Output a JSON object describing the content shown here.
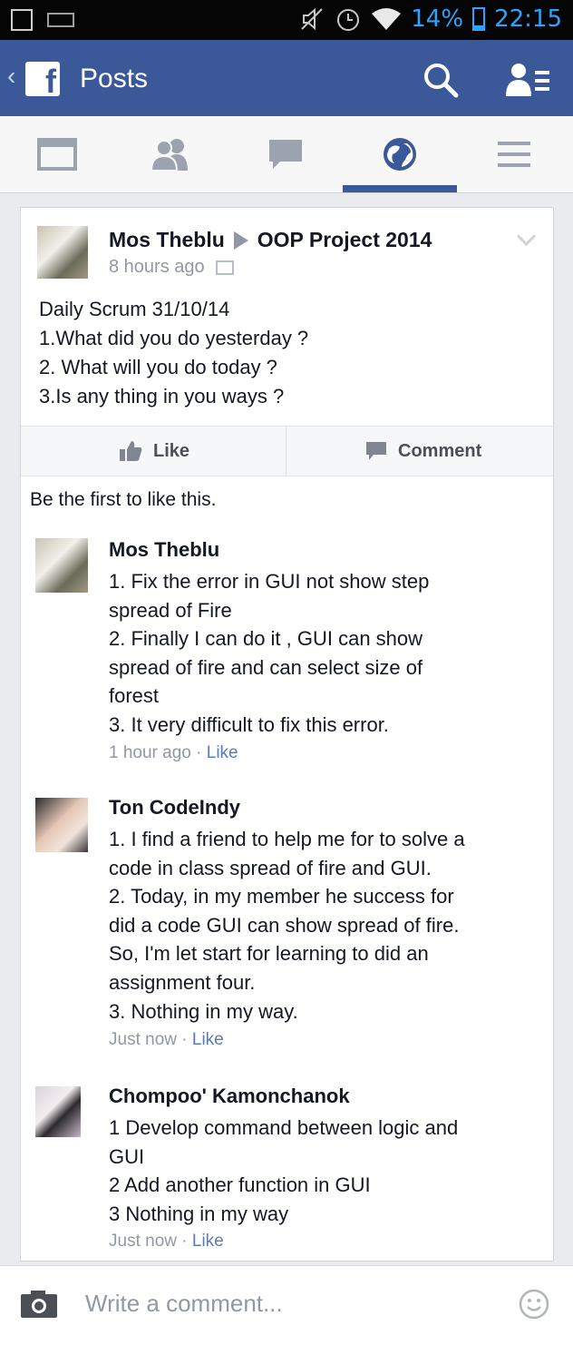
{
  "status_bar": {
    "battery": "14%",
    "time": "22:15"
  },
  "app_bar": {
    "title": "Posts"
  },
  "tabs": [
    {
      "name": "news-feed",
      "icon": "news-feed-icon"
    },
    {
      "name": "friend-requests",
      "icon": "friends-icon"
    },
    {
      "name": "messages",
      "icon": "chat-bubble-icon"
    },
    {
      "name": "notifications",
      "icon": "globe-icon",
      "active": true
    },
    {
      "name": "more",
      "icon": "menu-icon"
    }
  ],
  "post": {
    "author": "Mos Theblu",
    "group": "OOP Project 2014",
    "time": "8 hours ago",
    "lines": [
      "Daily Scrum 31/10/14",
      "1.What did you do yesterday ?",
      "2. What will you do today ?",
      "3.Is any thing in you ways ?"
    ],
    "like_label": "Like",
    "comment_label": "Comment",
    "likes_summary": "Be the first to like this."
  },
  "comments": [
    {
      "name": "Mos Theblu",
      "lines": [
        "1. Fix the error in GUI not show step",
        "spread of Fire",
        "2. Finally I can do it , GUI can show",
        "spread of fire and can select size of",
        "forest",
        "3. It very difficult to fix this error."
      ],
      "time": "1 hour ago",
      "like": "Like"
    },
    {
      "name": "Ton CodeIndy",
      "lines": [
        "1. I find a friend to help me for to solve a",
        "code in class spread of fire and GUI.",
        "2. Today, in my member he success for",
        "did a code GUI can show spread of fire.",
        "So, I'm let start for learning to did an",
        "assignment four.",
        "3. Nothing in my way."
      ],
      "time": "Just now",
      "like": "Like"
    },
    {
      "name": "Chompoo' Kamonchanok",
      "lines": [
        "1 Develop command between logic and",
        "GUI",
        "2 Add another function in GUI",
        "3 Nothing in my way"
      ],
      "time": "Just now",
      "like": "Like"
    }
  ],
  "composer": {
    "placeholder": "Write a comment..."
  },
  "colors": {
    "brand": "#3b5998",
    "status_blue": "#2aa4ff",
    "link": "#5b7bb4",
    "muted": "#9197a3"
  }
}
